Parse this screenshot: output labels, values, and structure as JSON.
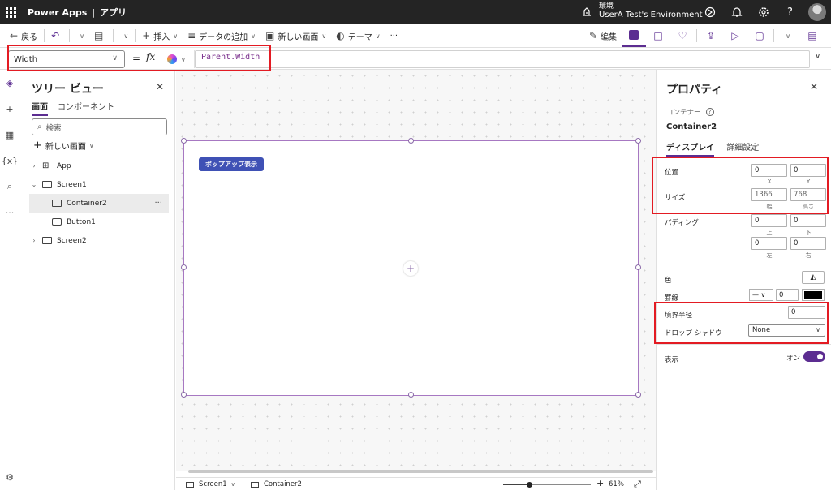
{
  "topbar": {
    "app_name": "Power Apps",
    "separator": "|",
    "app_title": "アプリ",
    "env_label": "環境",
    "env_name": "UserA Test's Environment",
    "icons": [
      "environment-icon",
      "copilot-icon",
      "notifications-icon",
      "settings-icon",
      "help-icon",
      "avatar"
    ]
  },
  "commandbar": {
    "back": "戻る",
    "insert": "挿入",
    "add_data": "データの追加",
    "new_screen": "新しい画面",
    "theme": "テーマ",
    "more": "···",
    "edit": "編集"
  },
  "formula_bar": {
    "property": "Width",
    "equals": "=",
    "fx": "fx",
    "formula": "Parent.Width"
  },
  "tree_view": {
    "title": "ツリー ビュー",
    "tabs": [
      "画面",
      "コンポーネント"
    ],
    "search_placeholder": "検索",
    "new_screen": "新しい画面",
    "items": [
      {
        "label": "App"
      },
      {
        "label": "Screen1"
      },
      {
        "label": "Container2"
      },
      {
        "label": "Button1"
      },
      {
        "label": "Screen2"
      }
    ],
    "more": "···"
  },
  "canvas": {
    "popup_button": "ポップアップ表示",
    "add": "+"
  },
  "statusbar": {
    "screen": "Screen1",
    "control": "Container2",
    "zoom": "61%",
    "zoom_fraction": 0.3
  },
  "properties": {
    "title": "プロパティ",
    "type": "コンテナー",
    "name": "Container2",
    "tabs": [
      "ディスプレイ",
      "詳細設定"
    ],
    "position_label": "位置",
    "x": "0",
    "y": "0",
    "x_sub": "X",
    "y_sub": "Y",
    "size_label": "サイズ",
    "width": "1366",
    "height": "768",
    "width_sub": "幅",
    "height_sub": "高さ",
    "padding_label": "パディング",
    "pad_top": "0",
    "pad_bottom": "0",
    "pad_left": "0",
    "pad_right": "0",
    "pad_top_sub": "上",
    "pad_bottom_sub": "下",
    "pad_left_sub": "左",
    "pad_right_sub": "右",
    "color_label": "色",
    "border_label": "罫線",
    "border_width": "0",
    "border_color": "#000000",
    "radius_label": "境界半径",
    "radius": "0",
    "shadow_label": "ドロップ シャドウ",
    "shadow": "None",
    "visible_label": "表示",
    "visible_state": "オン"
  },
  "colors": {
    "accent": "#5c2d91",
    "highlight": "#e31b23",
    "topbar": "#242424",
    "popup_button": "#3f51b5"
  }
}
